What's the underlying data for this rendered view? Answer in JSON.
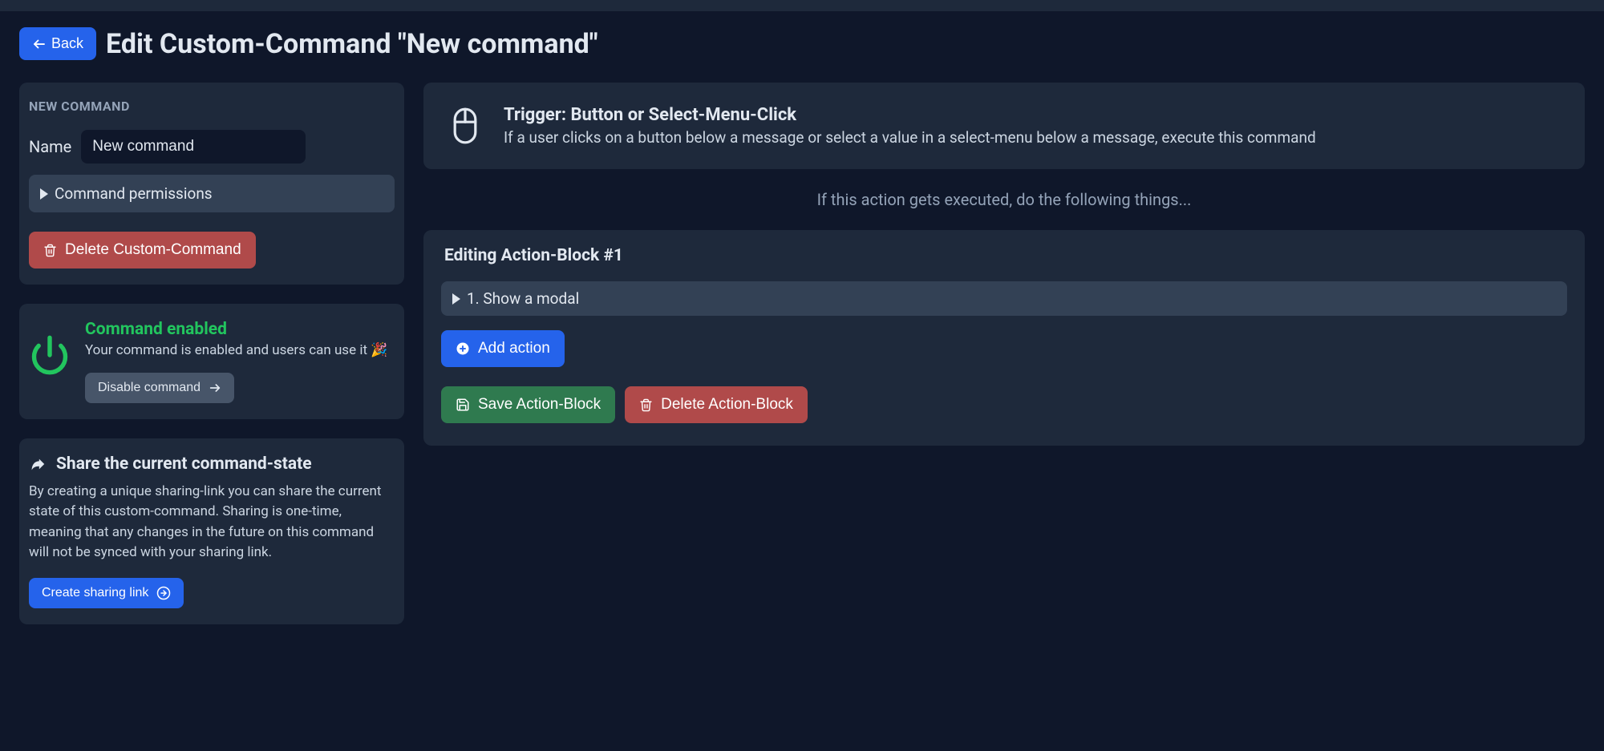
{
  "header": {
    "back_label": "Back",
    "page_title": "Edit Custom-Command \"New command\""
  },
  "command_panel": {
    "heading": "NEW COMMAND",
    "name_label": "Name",
    "name_value": "New command",
    "permissions_label": "Command permissions",
    "delete_label": "Delete Custom-Command"
  },
  "status_panel": {
    "title": "Command enabled",
    "description": "Your command is enabled and users can use it 🎉",
    "disable_label": "Disable command"
  },
  "share_panel": {
    "title": "Share the current command-state",
    "description": "By creating a unique sharing-link you can share the current state of this custom-command. Sharing is one-time, meaning that any changes in the future on this command will not be synced with your sharing link.",
    "create_link_label": "Create sharing link"
  },
  "trigger_panel": {
    "title": "Trigger: Button or Select-Menu-Click",
    "description": "If a user clicks on a button below a message or select a value in a select-menu below a message, execute this command"
  },
  "midline": "If this action gets executed, do the following things...",
  "action_block": {
    "title": "Editing Action-Block #1",
    "action_label": "1. Show a modal",
    "add_action_label": "Add action",
    "save_block_label": "Save Action-Block",
    "delete_block_label": "Delete Action-Block"
  }
}
